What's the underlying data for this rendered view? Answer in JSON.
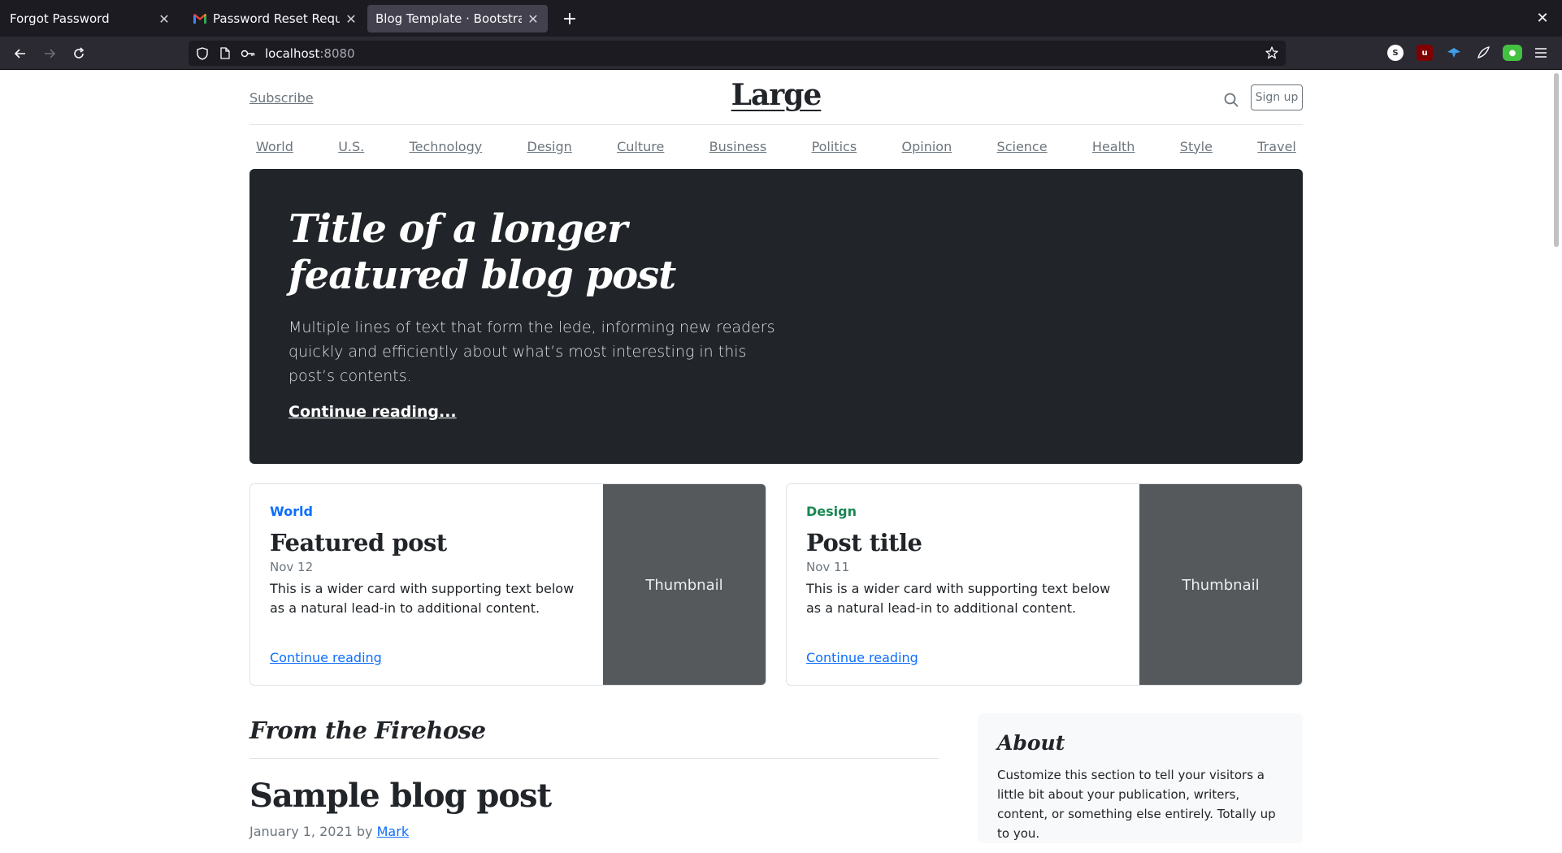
{
  "browser": {
    "tabs": [
      {
        "label": "Forgot Password"
      },
      {
        "label": "Password Reset Request"
      },
      {
        "label": "Blog Template · Bootstrap v5"
      }
    ],
    "url_host": "localhost",
    "url_port": ":8080"
  },
  "header": {
    "subscribe": "Subscribe",
    "logo": "Large",
    "signup": "Sign up"
  },
  "nav": {
    "items": [
      "World",
      "U.S.",
      "Technology",
      "Design",
      "Culture",
      "Business",
      "Politics",
      "Opinion",
      "Science",
      "Health",
      "Style",
      "Travel"
    ]
  },
  "hero": {
    "title": "Title of a longer featured blog post",
    "lede": "Multiple lines of text that form the lede, informing new readers quickly and efficiently about what’s most interesting in this post’s contents.",
    "link": "Continue reading..."
  },
  "cards": [
    {
      "category": "World",
      "category_color": "#0d6efd",
      "title": "Featured post",
      "date": "Nov 12",
      "text": "This is a wider card with supporting text below as a natural lead-in to additional content.",
      "link": "Continue reading",
      "thumb": "Thumbnail"
    },
    {
      "category": "Design",
      "category_color": "#198754",
      "title": "Post title",
      "date": "Nov 11",
      "text": "This is a wider card with supporting text below as a natural lead-in to additional content.",
      "link": "Continue reading",
      "thumb": "Thumbnail"
    }
  ],
  "firehose": {
    "heading": "From the Firehose",
    "post_title": "Sample blog post",
    "post_date": "January 1, 2021 by",
    "post_author": "Mark"
  },
  "about": {
    "title": "About",
    "text": "Customize this section to tell your visitors a little bit about your publication, writers, content, or something else entirely. Totally up to you."
  }
}
